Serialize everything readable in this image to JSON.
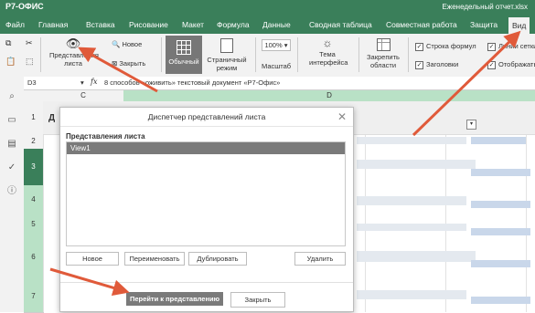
{
  "app": {
    "logo": "Р7-ОФИС",
    "file_name": "Еженедельный отчет.xlsx"
  },
  "tabs": [
    "Файл",
    "Главная",
    "Вставка",
    "Рисование",
    "Макет",
    "Формула",
    "Данные",
    "Сводная таблица",
    "Совместная работа",
    "Защита",
    "Вид"
  ],
  "ribbon": {
    "sheet_views_label": "Представления листа",
    "new_label": "Новое",
    "close_label": "Закрыть",
    "normal_label": "Обычный",
    "page_mode_label": "Страничный режим",
    "zoom_value": "100%",
    "zoom_label": "Масштаб",
    "theme_label": "Тема интерфейса",
    "freeze_label": "Закрепить области",
    "formula_bar_label": "Строка формул",
    "headings_label": "Заголовки",
    "gridlines_label": "Линии сетки",
    "show_zeros_label": "Отображать нули"
  },
  "formula_bar": {
    "cell_ref": "D3",
    "fx": "fx",
    "content": "8 способов «оживить» текстовый документ «Р7-Офис»"
  },
  "columns": [
    "C",
    "D"
  ],
  "rows": [
    "1",
    "2",
    "3",
    "4",
    "5",
    "6",
    "7"
  ],
  "cell_partial": "Д",
  "dialog": {
    "title": "Диспетчер представлений листа",
    "list_label": "Представления листа",
    "views": [
      "View1"
    ],
    "buttons": {
      "new": "Новое",
      "rename": "Переименовать",
      "duplicate": "Дублировать",
      "delete": "Удалить"
    },
    "go_to": "Перейти к представлению",
    "close": "Закрыть"
  },
  "colors": {
    "brand": "#3a7f5a",
    "arrow": "#e05a3a",
    "selected": "#7a7a7a"
  }
}
